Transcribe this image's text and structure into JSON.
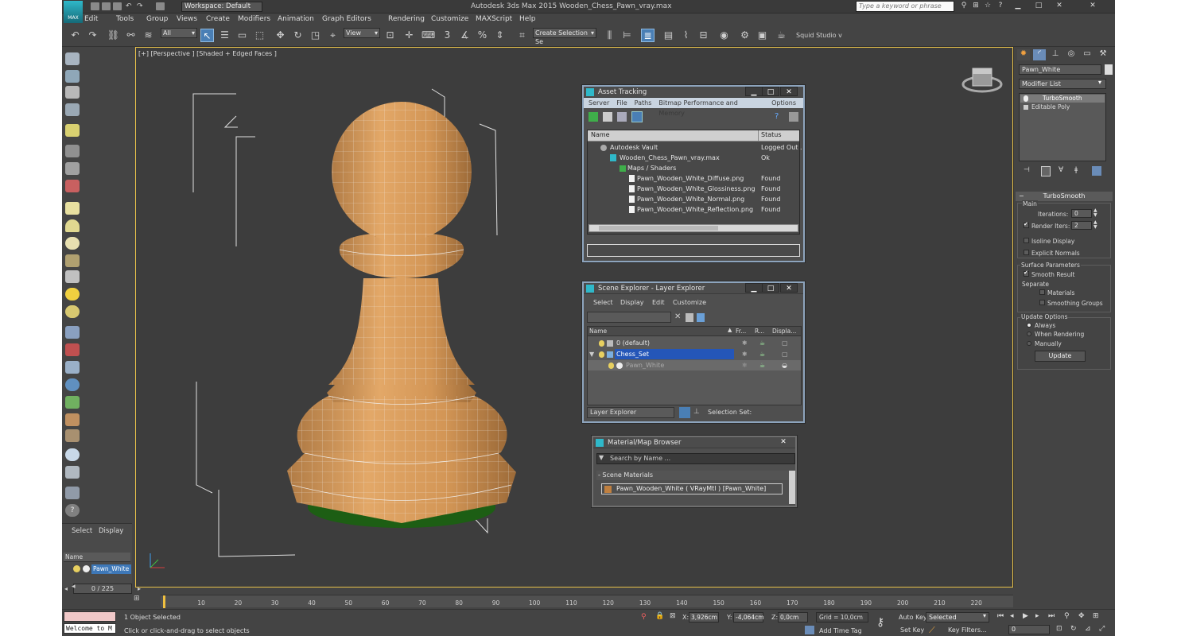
{
  "title_bar": {
    "workspace": "Workspace: Default",
    "app_title": "Autodesk 3ds Max 2015      Wooden_Chess_Pawn_vray.max",
    "search_placeholder": "Type a keyword or phrase",
    "logo_label": "MAX"
  },
  "menu": [
    "Edit",
    "Tools",
    "Group",
    "Views",
    "Create",
    "Modifiers",
    "Animation",
    "Graph Editors",
    "Rendering",
    "Customize",
    "MAXScript",
    "Help"
  ],
  "toolbar": {
    "selection_filter": "All",
    "ref_coord": "View",
    "selection_set": "Create Selection Se",
    "squid": "Squid Studio v",
    "snap_label": "3",
    "angle_snap": "%"
  },
  "left_panel": {
    "tabs": [
      "Select",
      "Display"
    ],
    "name_header": "Name",
    "item": "Pawn_White"
  },
  "viewport": {
    "label": "[+] [Perspective ] [Shaded + Edged Faces ]"
  },
  "asset_tracking": {
    "title": "Asset Tracking",
    "menu": [
      "Server",
      "File",
      "Paths",
      "Bitmap Performance and Memory",
      "Options"
    ],
    "columns": [
      "Name",
      "Status"
    ],
    "rows": [
      {
        "name": "Autodesk Vault",
        "status": "Logged Out ."
      },
      {
        "name": "Wooden_Chess_Pawn_vray.max",
        "status": "Ok"
      },
      {
        "name": "Maps / Shaders",
        "status": ""
      },
      {
        "name": "Pawn_Wooden_White_Diffuse.png",
        "status": "Found"
      },
      {
        "name": "Pawn_Wooden_White_Glossiness.png",
        "status": "Found"
      },
      {
        "name": "Pawn_Wooden_White_Normal.png",
        "status": "Found"
      },
      {
        "name": "Pawn_Wooden_White_Reflection.png",
        "status": "Found"
      }
    ]
  },
  "scene_explorer": {
    "title": "Scene Explorer - Layer Explorer",
    "menu": [
      "Select",
      "Display",
      "Edit",
      "Customize"
    ],
    "columns": [
      "Name",
      "Fr...",
      "R...",
      "Displa..."
    ],
    "rows": [
      "0 (default)",
      "Chess_Set",
      "Pawn_White"
    ],
    "footer_mode": "Layer Explorer",
    "footer_selset": "Selection Set:"
  },
  "material_browser": {
    "title": "Material/Map Browser",
    "search_placeholder": "Search by Name ...",
    "section": "- Scene Materials",
    "item": "Pawn_Wooden_White  ( VRayMtl )  [Pawn_White]"
  },
  "command_panel": {
    "object_name": "Pawn_White",
    "modifier_list": "Modifier List",
    "stack": [
      "TurboSmooth",
      "Editable Poly"
    ],
    "rollout_title": "TurboSmooth",
    "main_label": "Main",
    "iterations_label": "Iterations:",
    "iterations_value": "0",
    "render_iters_label": "Render Iters:",
    "render_iters_value": "2",
    "isoline": "Isoline Display",
    "explicit": "Explicit Normals",
    "surface_params": "Surface Parameters",
    "smooth_result": "Smooth Result",
    "separate": "Separate",
    "materials": "Materials",
    "smoothing_groups": "Smoothing Groups",
    "update_options": "Update Options",
    "always": "Always",
    "when_rendering": "When Rendering",
    "manually": "Manually",
    "update_btn": "Update"
  },
  "timeline": {
    "frame_counter": "0 / 225",
    "ticks": [
      "0",
      "10",
      "20",
      "30",
      "40",
      "50",
      "60",
      "70",
      "80",
      "90",
      "100",
      "110",
      "120",
      "130",
      "140",
      "150",
      "160",
      "170",
      "180",
      "190",
      "200",
      "210",
      "220"
    ]
  },
  "status": {
    "maxscript": "Welcome to M",
    "selected": "1 Object Selected",
    "prompt": "Click or click-and-drag to select objects",
    "x_label": "X:",
    "x": "3,926cm",
    "y_label": "Y:",
    "y": "-4,064cm",
    "z_label": "Z:",
    "z": "0,0cm",
    "grid": "Grid = 10,0cm",
    "add_time_tag": "Add Time Tag",
    "auto_key": "Auto Key",
    "set_key": "Set Key",
    "selected_dd": "Selected",
    "key_filters": "Key Filters...",
    "frame": "0"
  }
}
